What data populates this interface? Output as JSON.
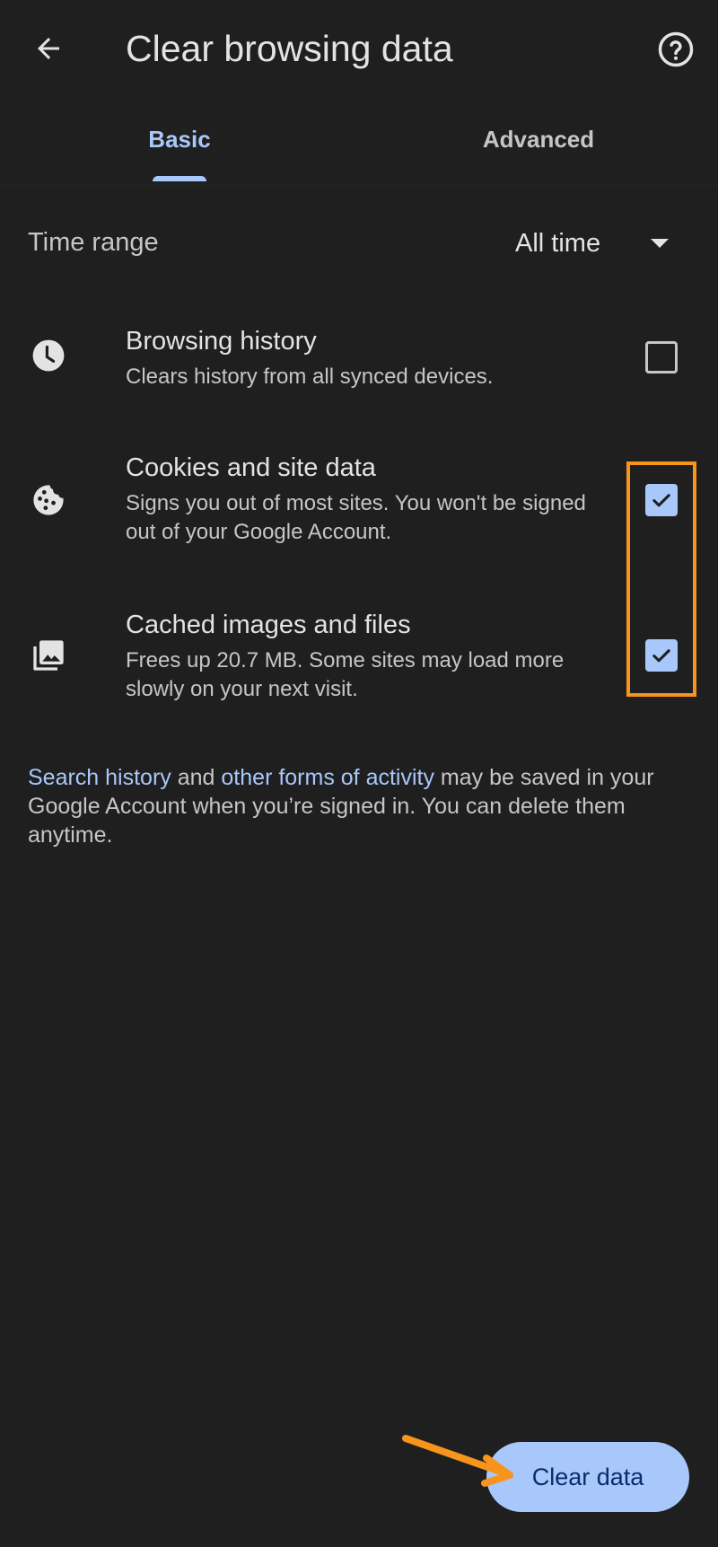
{
  "header": {
    "back_icon": "arrow-left-icon",
    "title": "Clear browsing data",
    "help_icon": "help-circle-icon"
  },
  "tabs": [
    {
      "label": "Basic",
      "selected": true
    },
    {
      "label": "Advanced",
      "selected": false
    }
  ],
  "time_range": {
    "label": "Time range",
    "value": "All time",
    "caret_icon": "dropdown-caret-icon"
  },
  "items": [
    {
      "icon": "clock-icon",
      "title": "Browsing history",
      "description": "Clears history from all synced devices.",
      "checked": false
    },
    {
      "icon": "cookie-icon",
      "title": "Cookies and site data",
      "description": "Signs you out of most sites. You won't be signed out of your Google Account.",
      "checked": true
    },
    {
      "icon": "images-icon",
      "title": "Cached images and files",
      "description": "Frees up 20.7 MB. Some sites may load more slowly on your next visit.",
      "checked": true
    }
  ],
  "footer_note": {
    "link1": "Search history",
    "text1": " and ",
    "link2": "other forms of activity",
    "text2": " may be saved in your Google Account when you’re signed in. You can delete them anytime."
  },
  "actions": {
    "clear_label": "Clear data"
  },
  "annotations": {
    "highlight_color": "#f7941d",
    "arrow_color": "#f7941d"
  },
  "colors": {
    "background": "#1f1f1f",
    "accent": "#a8c7fa",
    "button_text": "#062e6f"
  }
}
